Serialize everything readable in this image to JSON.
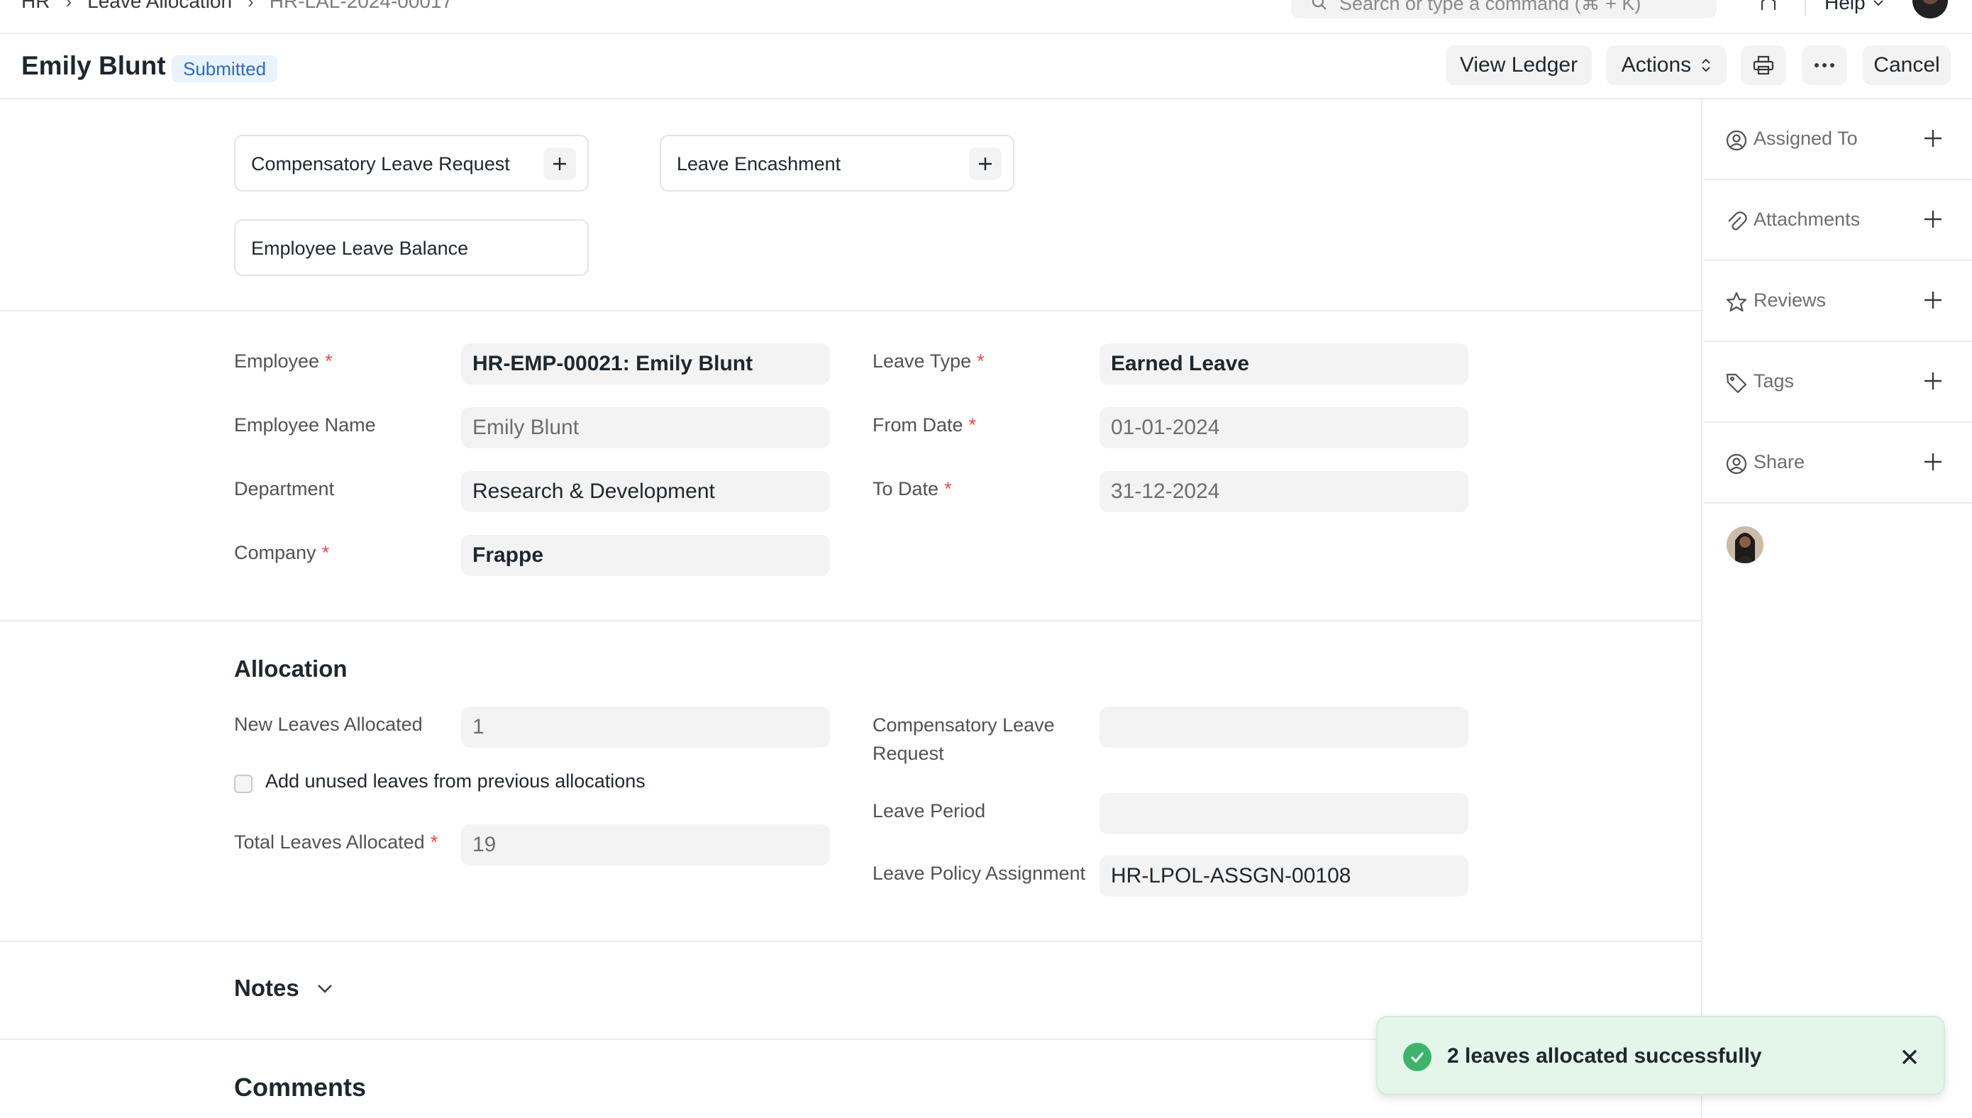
{
  "navbar": {
    "breadcrumbs": [
      "HR",
      "Leave Allocation",
      "HR-LAL-2024-00017"
    ],
    "search_placeholder": "Search or type a command (⌘ + K)",
    "help_label": "Help"
  },
  "header": {
    "title": "Emily Blunt",
    "status": "Submitted",
    "buttons": {
      "view_ledger": "View Ledger",
      "actions": "Actions",
      "cancel": "Cancel"
    }
  },
  "connections": [
    {
      "label": "Compensatory Leave Request"
    },
    {
      "label": "Leave Encashment"
    },
    {
      "label": "Employee Leave Balance"
    }
  ],
  "details": {
    "employee": {
      "label": "Employee",
      "value": "HR-EMP-00021: Emily Blunt"
    },
    "employee_name": {
      "label": "Employee Name",
      "value": "Emily Blunt"
    },
    "department": {
      "label": "Department",
      "value": "Research & Development"
    },
    "company": {
      "label": "Company",
      "value": "Frappe"
    },
    "leave_type": {
      "label": "Leave Type",
      "value": "Earned Leave"
    },
    "from_date": {
      "label": "From Date",
      "value": "01-01-2024"
    },
    "to_date": {
      "label": "To Date",
      "value": "31-12-2024"
    }
  },
  "allocation": {
    "title": "Allocation",
    "new_leaves": {
      "label": "New Leaves Allocated",
      "value": "1"
    },
    "add_unused_label": "Add unused leaves from previous allocations",
    "add_unused_checked": false,
    "total_leaves": {
      "label": "Total Leaves Allocated",
      "value": "19"
    },
    "comp_leave_request": {
      "label_line1": "Compensatory Leave",
      "label_line2": "Request",
      "value": ""
    },
    "leave_period": {
      "label": "Leave Period",
      "value": ""
    },
    "leave_policy": {
      "label": "Leave Policy Assignment",
      "value": "HR-LPOL-ASSGN-00108"
    }
  },
  "notes": {
    "title": "Notes"
  },
  "comments": {
    "title": "Comments"
  },
  "sidebar": {
    "items": [
      {
        "label": "Assigned To",
        "icon": "assign-icon"
      },
      {
        "label": "Attachments",
        "icon": "paperclip-icon"
      },
      {
        "label": "Reviews",
        "icon": "star-icon"
      },
      {
        "label": "Tags",
        "icon": "tag-icon"
      },
      {
        "label": "Share",
        "icon": "share-icon"
      }
    ]
  },
  "toast": {
    "message": "2 leaves allocated successfully"
  },
  "colors": {
    "accent_blue": "#2c6dbf",
    "badge_bg": "#eaf2fd",
    "required_red": "#e24c4c",
    "success_green": "#3fb36b",
    "toast_bg": "#e4f5e9"
  }
}
